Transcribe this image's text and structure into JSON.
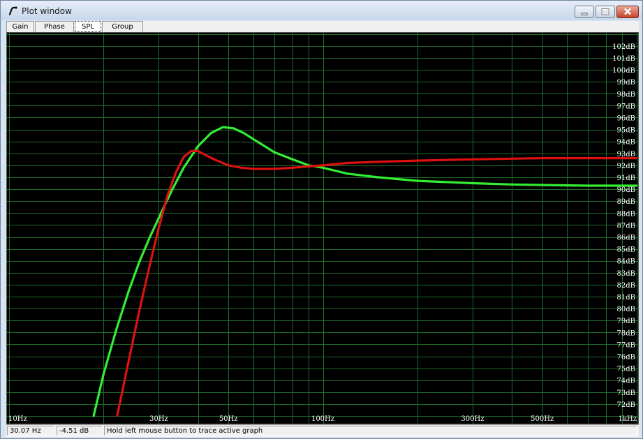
{
  "window": {
    "title": "Plot window",
    "icon": "curve-icon"
  },
  "tabs": [
    {
      "label": "Gain",
      "active": false
    },
    {
      "label": "Phase plot",
      "active": false
    },
    {
      "label": "SPL",
      "active": true
    },
    {
      "label": "Group delay",
      "active": false
    }
  ],
  "status": {
    "frequency": "30.07 Hz",
    "level": "-4.51 dB",
    "hint": "Hold left mouse button to trace active graph"
  },
  "colors": {
    "background": "#000000",
    "grid": "#1f6b2a",
    "series_green": "#33ee33",
    "series_red": "#dd1111"
  },
  "chart_data": {
    "type": "line",
    "x_scale": "log",
    "xlim": [
      10,
      1000
    ],
    "ylim": [
      71,
      103
    ],
    "x_ticks": [
      {
        "value": 10,
        "label": "10Hz"
      },
      {
        "value": 30,
        "label": "30Hz"
      },
      {
        "value": 50,
        "label": "50Hz"
      },
      {
        "value": 100,
        "label": "100Hz"
      },
      {
        "value": 300,
        "label": "300Hz"
      },
      {
        "value": 500,
        "label": "500Hz"
      },
      {
        "value": 1000,
        "label": "1kHz"
      }
    ],
    "y_tick_labels": [
      "102dB",
      "101dB",
      "100dB",
      "99dB",
      "98dB",
      "97dB",
      "96dB",
      "95dB",
      "94dB",
      "93dB",
      "92dB",
      "91dB",
      "90dB",
      "89dB",
      "88dB",
      "87dB",
      "86dB",
      "85dB",
      "84dB",
      "83dB",
      "82dB",
      "81dB",
      "80dB",
      "79dB",
      "78dB",
      "77dB",
      "76dB",
      "75dB",
      "74dB",
      "73dB",
      "72dB"
    ],
    "y_tick_values": [
      102,
      101,
      100,
      99,
      98,
      97,
      96,
      95,
      94,
      93,
      92,
      91,
      90,
      89,
      88,
      87,
      86,
      85,
      84,
      83,
      82,
      81,
      80,
      79,
      78,
      77,
      76,
      75,
      74,
      73,
      72
    ],
    "grid": true,
    "series": [
      {
        "color": "#33ee33",
        "x": [
          18.6,
          20,
          22,
          24,
          26,
          28,
          30,
          33,
          36,
          40,
          44,
          48,
          52,
          56,
          60,
          70,
          80,
          90,
          100,
          120,
          150,
          200,
          300,
          400,
          500,
          700,
          1000
        ],
        "y": [
          71,
          74.5,
          78.3,
          81.4,
          83.9,
          85.9,
          87.6,
          89.9,
          91.8,
          93.6,
          94.7,
          95.2,
          95.1,
          94.7,
          94.2,
          93.1,
          92.5,
          92.0,
          91.8,
          91.3,
          91.0,
          90.7,
          90.5,
          90.4,
          90.35,
          90.3,
          90.3
        ]
      },
      {
        "color": "#dd1111",
        "x": [
          22.1,
          24,
          26,
          28,
          30,
          32,
          34,
          36,
          38,
          40,
          42,
          45,
          50,
          55,
          60,
          70,
          80,
          100,
          120,
          150,
          200,
          300,
          500,
          1000
        ],
        "y": [
          71,
          75.5,
          79.8,
          83.5,
          86.8,
          89.5,
          91.4,
          92.7,
          93.2,
          93.2,
          92.9,
          92.5,
          92.0,
          91.8,
          91.7,
          91.7,
          91.8,
          92.0,
          92.2,
          92.3,
          92.4,
          92.5,
          92.6,
          92.6
        ]
      }
    ]
  }
}
